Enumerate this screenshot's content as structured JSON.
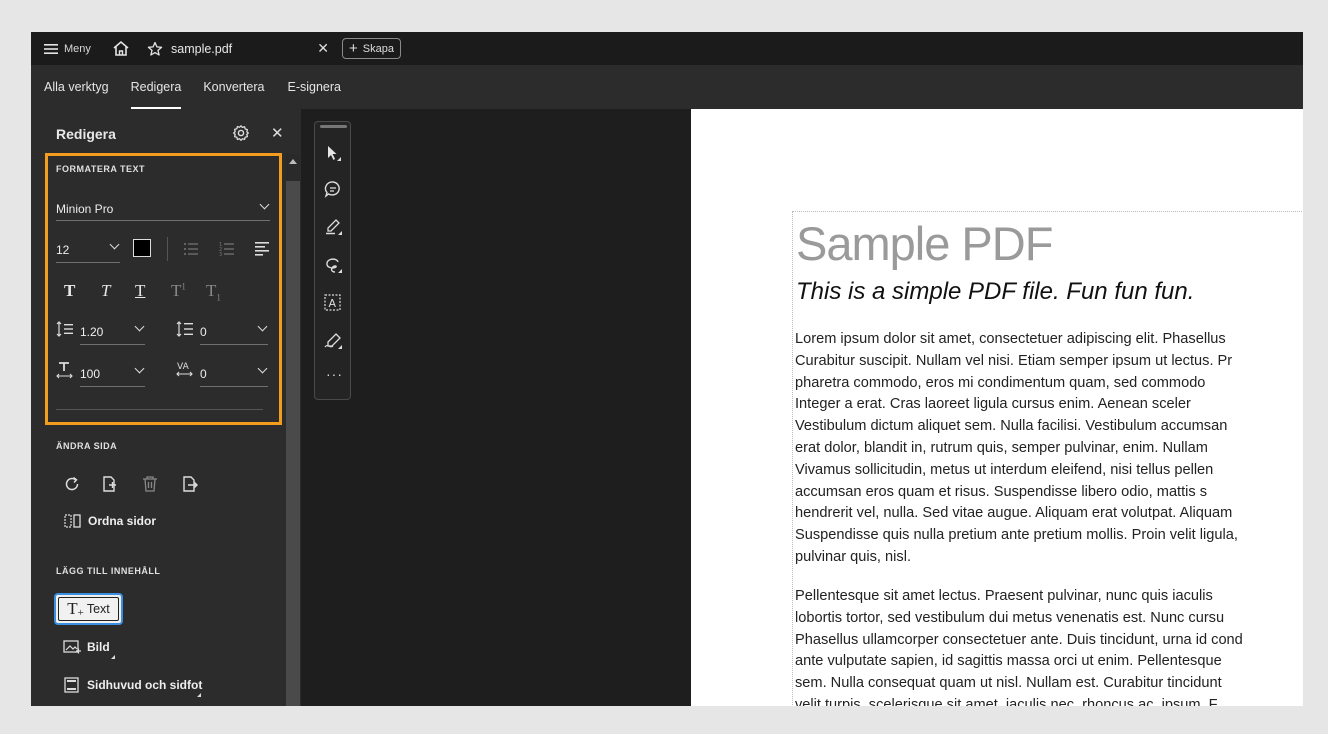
{
  "titlebar": {
    "menu_label": "Meny",
    "tab_title": "sample.pdf",
    "new_button_label": "Skapa"
  },
  "nav": {
    "items": [
      "Alla verktyg",
      "Redigera",
      "Konvertera",
      "E-signera"
    ],
    "active": "Redigera"
  },
  "sidebar": {
    "title": "Redigera",
    "format_section": {
      "title": "FORMATERA TEXT",
      "font": "Minion Pro",
      "size": "12",
      "line_spacing": "1.20",
      "paragraph_spacing": "0",
      "horizontal_scale": "100",
      "character_spacing": "0",
      "text_color": "#000000"
    },
    "page_section": {
      "title": "ÄNDRA SIDA",
      "organize_label": "Ordna sidor"
    },
    "add_section": {
      "title": "LÄGG TILL INNEHÅLL",
      "text_label": "Text",
      "image_label": "Bild",
      "header_footer_label": "Sidhuvud och sidfot"
    }
  },
  "toolstrip": {
    "tools": [
      "select-icon",
      "comment-icon",
      "highlight-icon",
      "draw-icon",
      "text-box-icon",
      "sign-icon",
      "more-icon"
    ]
  },
  "document": {
    "title": "Sample PDF",
    "subtitle": "This is a simple PDF file. Fun fun fun.",
    "paragraph1": [
      "Lorem ipsum dolor sit amet, consectetuer adipiscing elit. Phasellus",
      "Curabitur suscipit. Nullam vel nisi. Etiam semper ipsum ut lectus. Pr",
      "pharetra commodo, eros mi condimentum quam, sed commodo",
      "Integer a erat. Cras laoreet ligula cursus enim. Aenean sceler",
      "Vestibulum dictum aliquet sem. Nulla facilisi. Vestibulum accumsan",
      "erat dolor, blandit in, rutrum quis, semper pulvinar, enim. Nullam",
      "Vivamus sollicitudin, metus ut interdum eleifend, nisi tellus pellen",
      "accumsan eros quam et risus. Suspendisse libero odio, mattis s",
      "hendrerit vel, nulla. Sed vitae augue. Aliquam erat volutpat. Aliquam",
      "Suspendisse quis nulla pretium ante pretium mollis. Proin velit ligula,",
      "pulvinar quis, nisl."
    ],
    "paragraph2": [
      "Pellentesque sit amet lectus. Praesent pulvinar, nunc quis iaculis",
      "lobortis tortor, sed vestibulum dui metus venenatis est. Nunc cursu",
      "Phasellus ullamcorper consectetuer ante. Duis tincidunt, urna id cond",
      "ante vulputate sapien, id sagittis massa orci ut enim. Pellentesque",
      "sem. Nulla consequat quam ut nisl. Nullam est. Curabitur tincidunt",
      "velit turpis, scelerisque sit amet, iaculis nec, rhoncus ac, ipsum. F"
    ]
  },
  "colors": {
    "highlight_border": "#f29d1d",
    "focus_border": "#3b8fe0",
    "sidebar_bg": "#2c2c2c",
    "canvas_bg": "#1e1e1e"
  }
}
